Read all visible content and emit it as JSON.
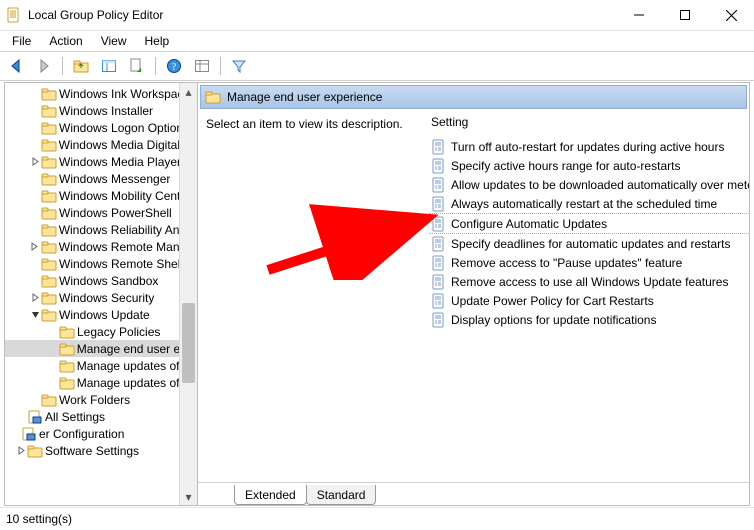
{
  "titlebar": {
    "title": "Local Group Policy Editor"
  },
  "menu": {
    "items": [
      "File",
      "Action",
      "View",
      "Help"
    ]
  },
  "tree": {
    "items": [
      {
        "label": "Windows Ink Workspace",
        "depth": 2,
        "exp": ""
      },
      {
        "label": "Windows Installer",
        "depth": 2,
        "exp": ""
      },
      {
        "label": "Windows Logon Options",
        "depth": 2,
        "exp": ""
      },
      {
        "label": "Windows Media Digital Rig",
        "depth": 2,
        "exp": ""
      },
      {
        "label": "Windows Media Player",
        "depth": 2,
        "exp": ">"
      },
      {
        "label": "Windows Messenger",
        "depth": 2,
        "exp": ""
      },
      {
        "label": "Windows Mobility Center",
        "depth": 2,
        "exp": ""
      },
      {
        "label": "Windows PowerShell",
        "depth": 2,
        "exp": ""
      },
      {
        "label": "Windows Reliability Analys",
        "depth": 2,
        "exp": ""
      },
      {
        "label": "Windows Remote Manage",
        "depth": 2,
        "exp": ">"
      },
      {
        "label": "Windows Remote Shell",
        "depth": 2,
        "exp": ""
      },
      {
        "label": "Windows Sandbox",
        "depth": 2,
        "exp": ""
      },
      {
        "label": "Windows Security",
        "depth": 2,
        "exp": ">"
      },
      {
        "label": "Windows Update",
        "depth": 2,
        "exp": "v"
      },
      {
        "label": "Legacy Policies",
        "depth": 3,
        "exp": ""
      },
      {
        "label": "Manage end user expe",
        "depth": 3,
        "exp": "",
        "selected": true
      },
      {
        "label": "Manage updates offere",
        "depth": 3,
        "exp": ""
      },
      {
        "label": "Manage updates offere",
        "depth": 3,
        "exp": ""
      },
      {
        "label": "Work Folders",
        "depth": 2,
        "exp": ""
      },
      {
        "label": "All Settings",
        "depth": 1,
        "exp": "",
        "icon": "shield"
      },
      {
        "label": "er Configuration",
        "depth": 0,
        "exp": "",
        "icon": "shield"
      },
      {
        "label": "Software Settings",
        "depth": 1,
        "exp": ">"
      }
    ]
  },
  "section": {
    "title": "Manage end user experience"
  },
  "description": {
    "prompt": "Select an item to view its description."
  },
  "columns": {
    "setting": "Setting"
  },
  "settings": [
    {
      "label": "Turn off auto-restart for updates during active hours",
      "sep": false
    },
    {
      "label": "Specify active hours range for auto-restarts",
      "sep": false
    },
    {
      "label": "Allow updates to be downloaded automatically over metere",
      "sep": false
    },
    {
      "label": "Always automatically restart at the scheduled time",
      "sep": true
    },
    {
      "label": "Configure Automatic Updates",
      "sep": true
    },
    {
      "label": "Specify deadlines for automatic updates and restarts",
      "sep": false
    },
    {
      "label": "Remove access to \"Pause updates\" feature",
      "sep": false
    },
    {
      "label": "Remove access to use all Windows Update features",
      "sep": false
    },
    {
      "label": "Update Power Policy for Cart Restarts",
      "sep": false
    },
    {
      "label": "Display options for update notifications",
      "sep": false
    }
  ],
  "tabs": {
    "extended": "Extended",
    "standard": "Standard"
  },
  "status": {
    "text": "10 setting(s)"
  },
  "colors": {
    "accent": "#0a3f8f",
    "arrow": "#ff0000"
  }
}
